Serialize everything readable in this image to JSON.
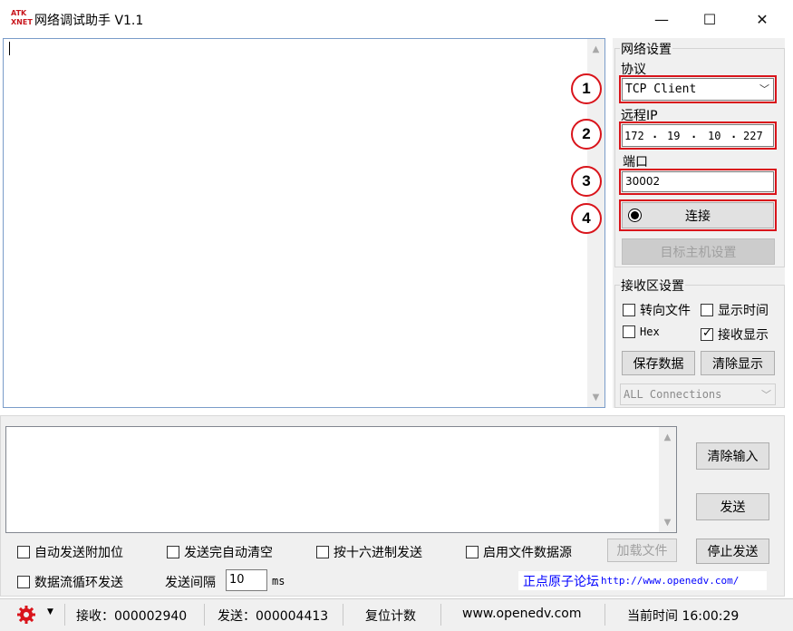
{
  "window": {
    "title": "网络调试助手 V1.1",
    "logo_text_line1": "ATK",
    "logo_text_line2": "XNET",
    "minimize_glyph": "—",
    "maximize_glyph": "☐",
    "close_glyph": "✕"
  },
  "network_settings": {
    "group_label": "网络设置",
    "protocol_label": "协议",
    "protocol_value": "TCP Client",
    "remote_ip_label": "远程IP",
    "ip_octets": [
      "172",
      "19",
      "10",
      "227"
    ],
    "port_label": "端口",
    "port_value": "30002",
    "connect_label": "连接",
    "host_settings_label": "目标主机设置"
  },
  "annotations": {
    "badges": [
      "1",
      "2",
      "3",
      "4"
    ],
    "color": "#d9141b"
  },
  "receive_settings": {
    "group_label": "接收区设置",
    "redirect_file_label": "转向文件",
    "show_time_label": "显示时间",
    "hex_label": "Hex",
    "receive_display_label": "接收显示",
    "receive_display_checked": true,
    "save_data_label": "保存数据",
    "clear_display_label": "清除显示",
    "connections_value": "ALL Connections"
  },
  "send_panel": {
    "clear_input_label": "清除输入",
    "send_label": "发送",
    "load_file_label": "加载文件",
    "stop_send_label": "停止发送",
    "auto_append_label": "自动发送附加位",
    "auto_clear_label": "发送完自动清空",
    "hex_send_label": "按十六进制发送",
    "file_source_label": "启用文件数据源",
    "loop_send_label": "数据流循环发送",
    "interval_label": "发送间隔",
    "interval_value": "10",
    "interval_unit": "ms",
    "forum_label": "正点原子论坛",
    "forum_url": "http://www.openedv.com/"
  },
  "statusbar": {
    "recv_text": "接收：000002940",
    "sent_text": "发送：000004413",
    "reset_label": "复位计数",
    "website": "www.openedv.com",
    "time_text": "当前时间 16:00:29"
  }
}
